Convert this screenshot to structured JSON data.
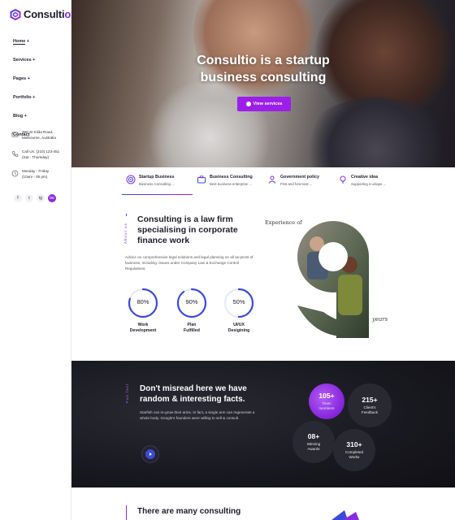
{
  "brand": {
    "name_main": "Consulti",
    "name_accent": "o"
  },
  "nav": [
    {
      "label": "Home",
      "suffix": "+"
    },
    {
      "label": "Services",
      "suffix": "+"
    },
    {
      "label": "Pages",
      "suffix": "+"
    },
    {
      "label": "Portfolio",
      "suffix": "+"
    },
    {
      "label": "Blog",
      "suffix": "+"
    },
    {
      "label": "Contact",
      "suffix": ""
    }
  ],
  "contact": {
    "address_line1": "388 St Kilda Road,",
    "address_line2": "Melbourne, Australia",
    "phone_line1": "Call Us: (210) 123-451",
    "phone_line2": "(Sat - Thursday)",
    "hours_line1": "Monday - Friday",
    "hours_line2": "(10am - 05 pm)"
  },
  "socials": [
    "f",
    "t",
    "ig",
    "be"
  ],
  "hero": {
    "title_line1": "Consultio is a startup",
    "title_line2": "business consulting",
    "button_label": "View services"
  },
  "tabs": [
    {
      "title": "Startup Business",
      "sub": "Business Consulting ..."
    },
    {
      "title": "Business Consulting",
      "sub": "Best business enterprise ..."
    },
    {
      "title": "Government policy",
      "sub": "First and foremost ..."
    },
    {
      "title": "Creative idea",
      "sub": "Supporting a unique ..."
    }
  ],
  "about": {
    "label": "About us",
    "title": "Consulting is a law firm specialising in corporate finance work",
    "text": "Advice on comprehensive legal solutions and legal planning on all as-pects of business, including: issues under Company Law & Exchange Control Regulations.",
    "circles": [
      {
        "value": "80%",
        "percent": 80,
        "label_line1": "Work",
        "label_line2": "Development"
      },
      {
        "value": "90%",
        "percent": 90,
        "label_line1": "Plan",
        "label_line2": "Fulfilled"
      },
      {
        "value": "50%",
        "percent": 50,
        "label_line1": "UI/UX",
        "label_line2": "Desigining"
      }
    ],
    "experience_label": "Experience of",
    "experience_years": "years"
  },
  "facts": {
    "label": "Fun fact",
    "title": "Don't misread here we have random & interesting facts.",
    "text": "Starfish can re-grow their arms. In fact, a single arm can regenerate a whole body. Google's founders were willing to sell & consult.",
    "stats": [
      {
        "num": "105+",
        "label_line1": "Team",
        "label_line2": "members"
      },
      {
        "num": "215+",
        "label_line1": "Client's",
        "label_line2": "Feedback"
      },
      {
        "num": "08+",
        "label_line1": "Winning",
        "label_line2": "Awards"
      },
      {
        "num": "310+",
        "label_line1": "Completed",
        "label_line2": "Works"
      }
    ]
  },
  "bottom": {
    "label": "Services",
    "title": "There are many consulting"
  },
  "colors": {
    "accent": "#8a2be2",
    "accent_blue": "#3b4bd8",
    "dark": "#1d1d2c"
  }
}
